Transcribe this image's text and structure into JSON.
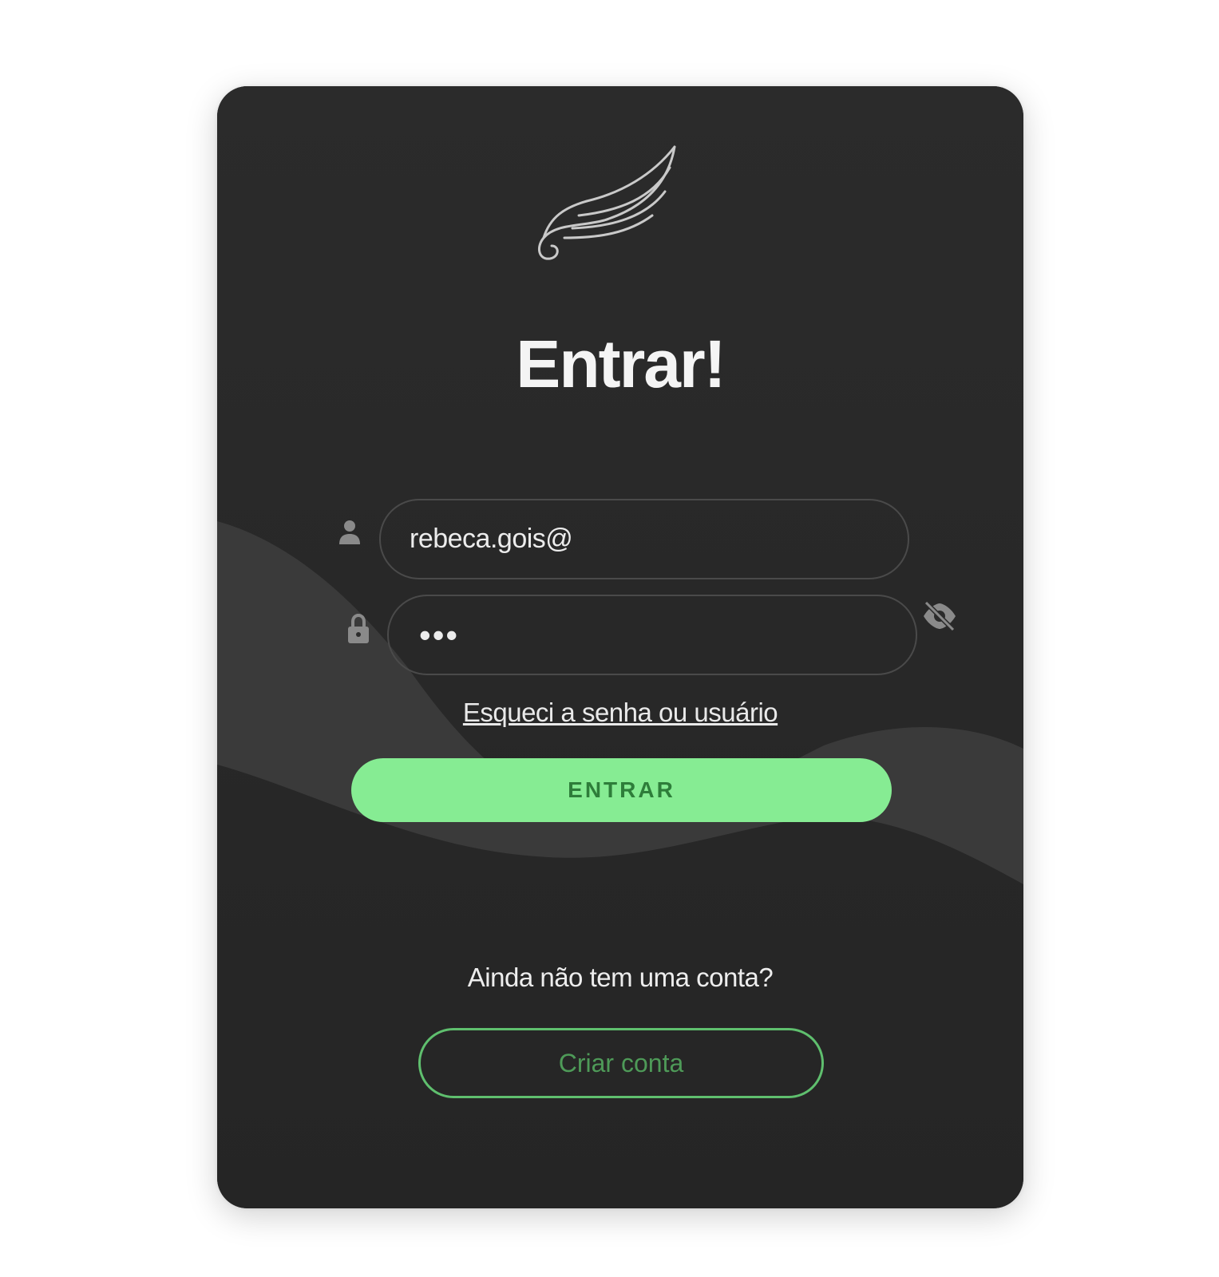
{
  "login": {
    "title": "Entrar!",
    "email_value": "rebeca.gois@",
    "password_value": "•••",
    "forgot_link": "Esqueci a senha ou usuário",
    "enter_button": "ENTRAR",
    "no_account_text": "Ainda não tem uma conta?",
    "create_account_button": "Criar conta"
  },
  "icons": {
    "logo": "wing-logo",
    "user": "user-icon",
    "lock": "lock-icon",
    "toggle_password": "eye-slash-icon"
  },
  "colors": {
    "card_background": "#2b2b2b",
    "accent_green": "#86ec93",
    "accent_green_text": "#2e7d3a",
    "outline_green": "#5fbf6e"
  }
}
